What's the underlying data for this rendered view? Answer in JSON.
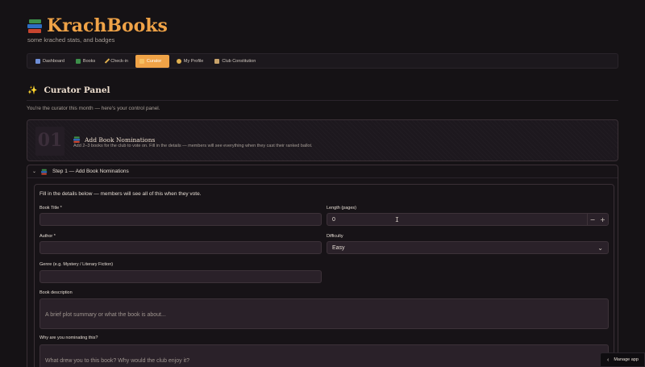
{
  "header": {
    "title": "KrachBooks",
    "subtitle": "some krached stats, and badges"
  },
  "nav": {
    "tabs": [
      {
        "label": "Dashboard",
        "icon": "bar-chart-icon",
        "color": "#6f8fd8"
      },
      {
        "label": "Books",
        "icon": "books-icon",
        "color": "#3d8f4a"
      },
      {
        "label": "Check-in",
        "icon": "pencil-icon",
        "color": "#e0b050"
      },
      {
        "label": "Curator",
        "icon": "star-icon",
        "color": "#f0a347",
        "active": true
      },
      {
        "label": "My Profile",
        "icon": "medal-icon",
        "color": "#e0b050"
      },
      {
        "label": "Club Constitution",
        "icon": "scroll-icon",
        "color": "#c7a26a"
      }
    ]
  },
  "panel": {
    "title": "Curator Panel",
    "intro": "You're the curator this month — here's your control panel."
  },
  "step_banner": {
    "number": "01",
    "title": "Add Book Nominations",
    "description": "Add 2–3 books for the club to vote on. Fill in the details — members will see everything when they cast their ranked ballot."
  },
  "expander": {
    "title": "Step 1 — Add Book Nominations",
    "expanded": true
  },
  "form": {
    "intro": "Fill in the details below — members will see all of this when they vote.",
    "book_title": {
      "label": "Book Title *",
      "value": ""
    },
    "length": {
      "label": "Length (pages)",
      "value": "0",
      "decrement": "−",
      "increment": "+"
    },
    "author": {
      "label": "Author *",
      "value": ""
    },
    "difficulty": {
      "label": "Difficulty",
      "value": "Easy"
    },
    "genre": {
      "label": "Genre (e.g. Mystery / Literary Fiction)",
      "value": ""
    },
    "description": {
      "label": "Book description",
      "placeholder": "A brief plot summary or what the book is about..."
    },
    "why": {
      "label": "Why are you nominating this?",
      "placeholder": "What drew you to this book? Why would the club enjoy it?"
    }
  },
  "manage_app": {
    "label": "Manage app"
  },
  "colors": {
    "accent": "#f0a347",
    "background": "#151215",
    "input_bg": "#2a2129"
  }
}
